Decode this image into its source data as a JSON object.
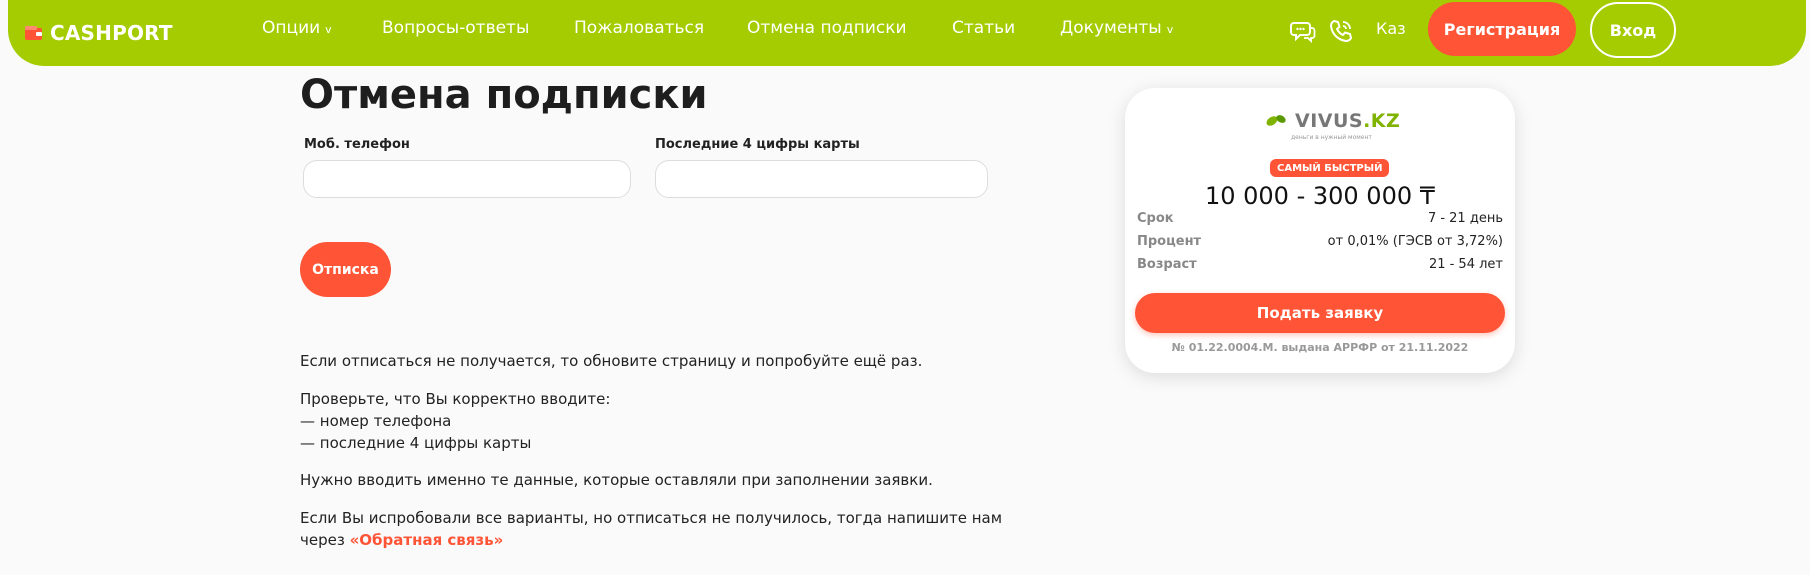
{
  "header": {
    "logo": "CASHPORT",
    "nav": [
      {
        "label": "Опции",
        "dropdown": true
      },
      {
        "label": "Вопросы-ответы",
        "dropdown": false
      },
      {
        "label": "Пожаловаться",
        "dropdown": false
      },
      {
        "label": "Отмена подписки",
        "dropdown": false
      },
      {
        "label": "Статьи",
        "dropdown": false
      },
      {
        "label": "Документы",
        "dropdown": true
      }
    ],
    "chevron": "v",
    "icons": [
      "chat-icon",
      "phone-icon"
    ],
    "language": "Каз",
    "register_label": "Регистрация",
    "login_label": "Вход"
  },
  "main": {
    "title": "Отмена подписки",
    "phone_label": "Моб. телефон",
    "phone_value": "",
    "card_label": "Последние 4 цифры карты",
    "card_value": "",
    "submit_label": "Отписка",
    "p1": "Если отписаться не получается, то обновите страницу и попробуйте ещё раз.",
    "p2_line1": "Проверьте, что Вы корректно вводите:",
    "p2_line2": "— номер телефона",
    "p2_line3": "— последние 4 цифры карты",
    "p3": "Нужно вводить именно те данные, которые оставляли при заполнении заявки.",
    "p4_line1": "Если Вы испробовали все варианты, но отписаться не получилось, тогда напишите нам",
    "p4_line2": "через",
    "feedback_link": "«Обратная связь»"
  },
  "offer": {
    "brand_main": "VIVUS",
    "brand_suffix": ".KZ",
    "brand_tagline": "деньги в нужный момент",
    "badge": "САМЫЙ БЫСТРЫЙ",
    "amount": "10 000 - 300 000 ₸",
    "rows": [
      {
        "key": "Срок",
        "value": "7 - 21 день"
      },
      {
        "key": "Процент",
        "value": "от 0,01% (ГЭСВ от 3,72%)"
      },
      {
        "key": "Возраст",
        "value": "21 - 54 лет"
      }
    ],
    "apply_label": "Подать заявку",
    "license": "№ 01.22.0004.М. выдана АРРФР от 21.11.2022"
  },
  "colors": {
    "header_bg": "#a4cc00",
    "accent": "#ff5436",
    "brand_green": "#7fb300"
  }
}
